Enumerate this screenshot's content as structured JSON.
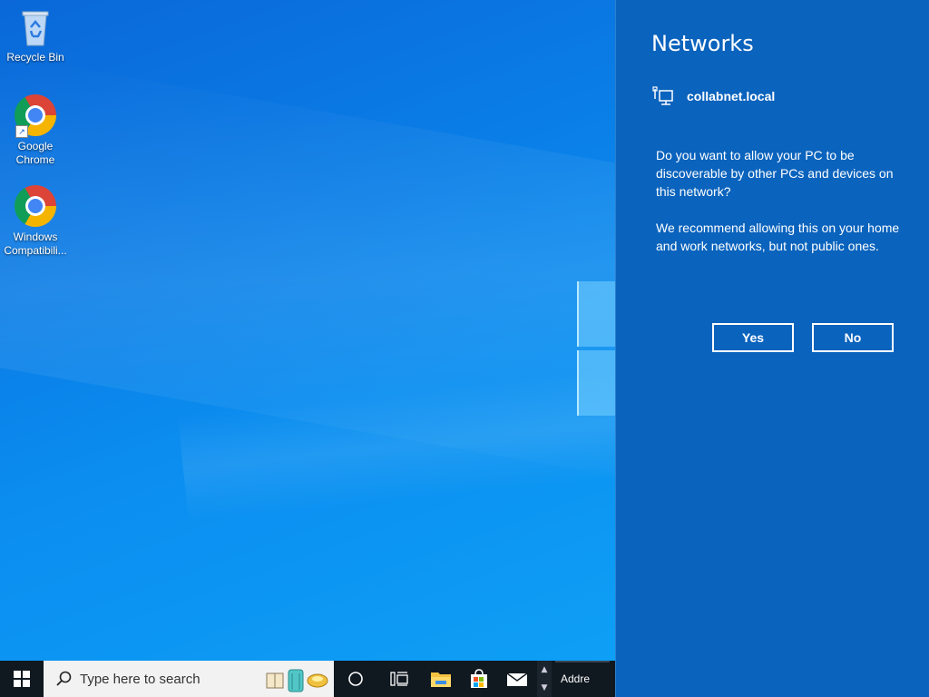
{
  "desktop": {
    "icons": [
      {
        "label": "Recycle Bin",
        "icon": "recycle-bin-icon"
      },
      {
        "label_line1": "Google",
        "label_line2": "Chrome",
        "icon": "chrome-icon"
      },
      {
        "label_line1": "Windows",
        "label_line2": "Compatibili...",
        "icon": "chrome-icon"
      }
    ]
  },
  "networks_panel": {
    "title": "Networks",
    "network_name": "collabnet.local",
    "network_icon": "wired-network-icon",
    "question": "Do you want to allow your PC to be discoverable by other PCs and devices on this network?",
    "recommendation": "We recommend allowing this on your home and work networks, but not public ones.",
    "yes_label": "Yes",
    "no_label": "No",
    "background_color": "#0a63bd"
  },
  "taskbar": {
    "start_icon": "windows-logo-icon",
    "search_placeholder": "Type here to search",
    "pinned": [
      "cortana-icon",
      "task-view-icon",
      "file-explorer-icon",
      "microsoft-store-icon",
      "mail-icon"
    ],
    "address_label": "Addre"
  }
}
